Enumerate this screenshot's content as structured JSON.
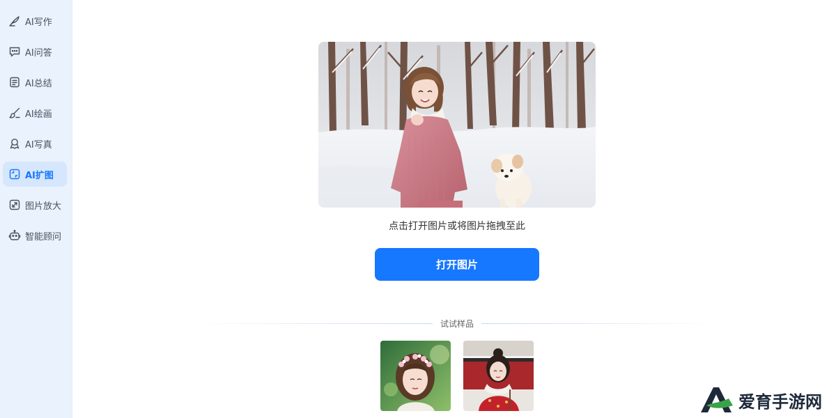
{
  "sidebar": {
    "items": [
      {
        "label": "AI写作",
        "icon": "feather-pen-icon",
        "active": false
      },
      {
        "label": "AI问答",
        "icon": "chat-bubble-icon",
        "active": false
      },
      {
        "label": "AI总结",
        "icon": "document-icon",
        "active": false
      },
      {
        "label": "AI绘画",
        "icon": "paintbrush-icon",
        "active": false
      },
      {
        "label": "AI写真",
        "icon": "portrait-icon",
        "active": false
      },
      {
        "label": "AI扩图",
        "icon": "expand-image-icon",
        "active": true
      },
      {
        "label": "图片放大",
        "icon": "upscale-icon",
        "active": false
      },
      {
        "label": "智能顾问",
        "icon": "robot-icon",
        "active": false
      }
    ]
  },
  "main": {
    "preview_image": "snowy-forest-girl-with-puppy-photo",
    "hint": "点击打开图片或将图片拖拽至此",
    "open_button": "打开图片",
    "samples_title": "试试样品",
    "samples": [
      {
        "image": "girl-with-flower-crown-photo"
      },
      {
        "image": "girl-in-red-coat-photo"
      }
    ]
  },
  "watermark": {
    "text": "爱育手游网"
  },
  "colors": {
    "accent": "#1677ff",
    "sidebar_bg": "#eaf2fd",
    "active_bg": "#d6e7fd"
  }
}
